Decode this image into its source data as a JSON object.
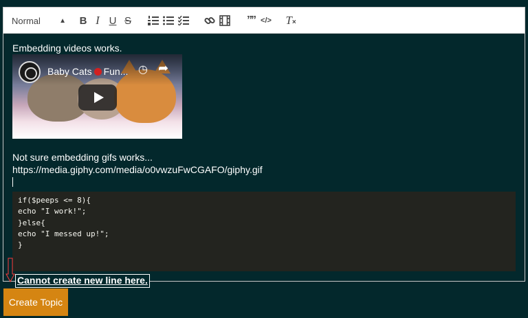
{
  "toolbar": {
    "format_select": {
      "selected": "Normal"
    },
    "buttons": [
      {
        "icon": "bold-icon",
        "label": "B"
      },
      {
        "icon": "italic-icon",
        "label": "I"
      },
      {
        "icon": "underline-icon",
        "label": "U"
      },
      {
        "icon": "strike-icon",
        "label": "S"
      },
      {
        "icon": "ordered-list-icon"
      },
      {
        "icon": "bullet-list-icon"
      },
      {
        "icon": "check-list-icon"
      },
      {
        "icon": "link-icon"
      },
      {
        "icon": "video-icon"
      },
      {
        "icon": "blockquote-icon",
        "label": "99"
      },
      {
        "icon": "code-icon",
        "label": "</>"
      },
      {
        "icon": "clear-format-icon",
        "label": "Tx"
      }
    ]
  },
  "content": {
    "line1": "Embedding videos works.",
    "video": {
      "title": "Baby Cats",
      "title_tail": "Fun..."
    },
    "line2": "Not sure embedding gifs works...",
    "line3": "https://media.giphy.com/media/o0vwzuFwCGAFO/giphy.gif",
    "code": "if($peeps <= 8){\necho \"I work!\";\n}else{\necho \"I messed up!\";\n}"
  },
  "annotation": {
    "text": "Cannot create new line here.",
    "color": "#ff3b3b"
  },
  "submit": {
    "label": "Create Topic",
    "color": "#d58512"
  },
  "colors": {
    "background": "#03282c",
    "code_bg": "#23241f"
  }
}
